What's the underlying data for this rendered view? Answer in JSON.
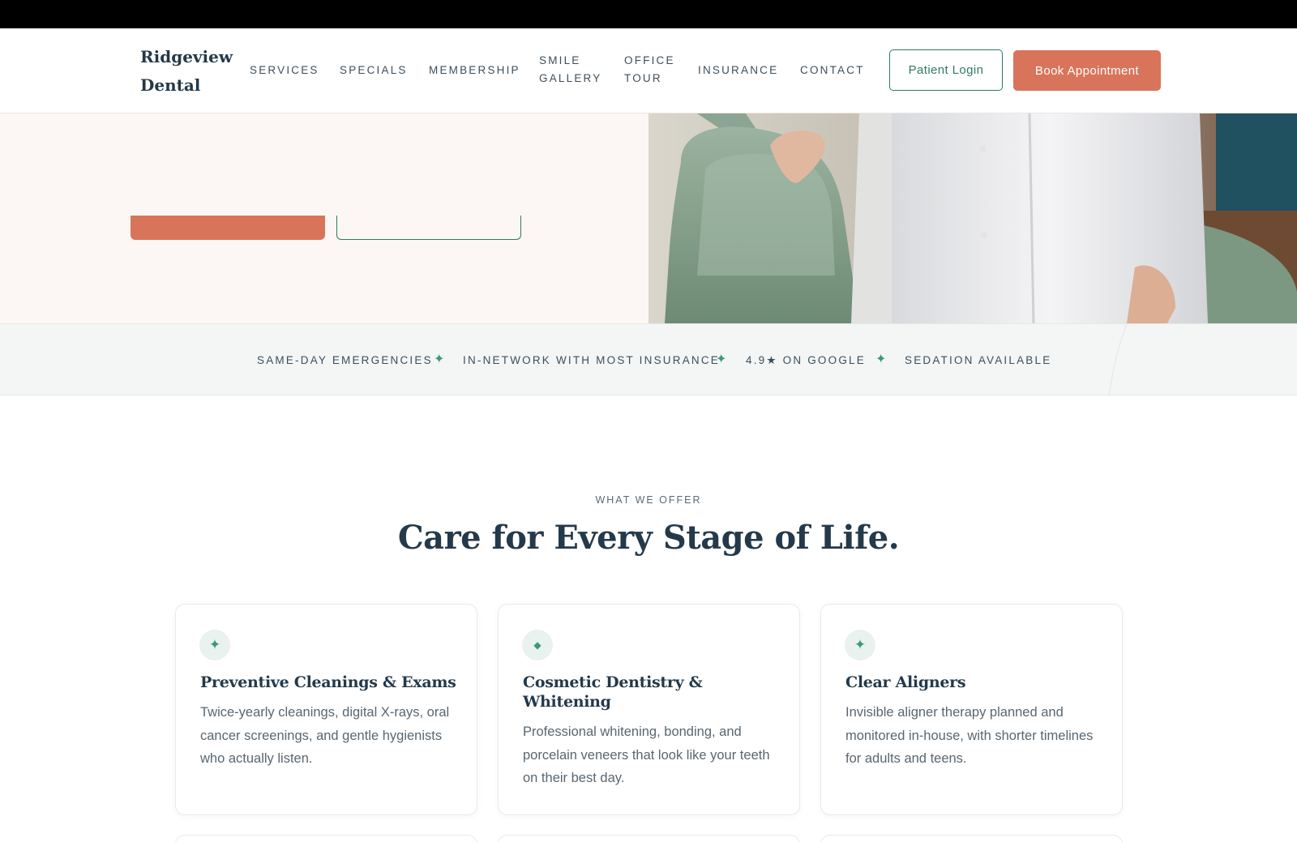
{
  "brand": {
    "name_line1": "Ridgeview",
    "name_line2": "Dental"
  },
  "nav": {
    "items": [
      {
        "label": "SERVICES"
      },
      {
        "label": "SPECIALS"
      },
      {
        "label": "MEMBERSHIP"
      },
      {
        "label_line1": "SMILE",
        "label_line2": "GALLERY"
      },
      {
        "label_line1": "OFFICE",
        "label_line2": "TOUR"
      },
      {
        "label": "INSURANCE"
      },
      {
        "label": "CONTACT"
      }
    ],
    "login_label": "Patient Login",
    "book_label": "Book Appointment"
  },
  "trust_strip": {
    "items": [
      "SAME-DAY EMERGENCIES",
      "IN-NETWORK WITH MOST INSURANCE",
      "4.9★ ON GOOGLE",
      "SEDATION AVAILABLE"
    ],
    "separator": "✦"
  },
  "services": {
    "eyebrow": "WHAT WE OFFER",
    "title": "Care for Every Stage of Life.",
    "cards": [
      {
        "icon": "sparkle-icon",
        "glyph": "✦",
        "title": "Preventive Cleanings & Exams",
        "text": "Twice-yearly cleanings, digital X-rays, oral cancer screenings, and gentle hygienists who actually listen."
      },
      {
        "icon": "diamond-icon",
        "glyph": "◆",
        "title": "Cosmetic Dentistry & Whitening",
        "text": "Professional whitening, bonding, and porcelain veneers that look like your teeth on their best day."
      },
      {
        "icon": "sparkle-icon",
        "glyph": "✦",
        "title": "Clear Aligners",
        "text": "Invisible aligner therapy planned and monitored in-house, with shorter timelines for adults and teens."
      }
    ]
  },
  "colors": {
    "accent_coral": "#d8745a",
    "accent_green": "#2f7a66",
    "ink": "#24394a",
    "hero_bg": "#fcf7f4",
    "strip_bg": "#f3f6f5"
  }
}
